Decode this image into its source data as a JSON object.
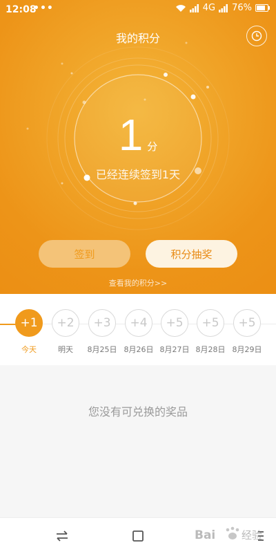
{
  "status_bar": {
    "time": "12:08",
    "dots": "•••",
    "network": "4G",
    "battery": "76%"
  },
  "header": {
    "title": "我的积分",
    "history_icon": "clock-icon"
  },
  "score": {
    "value": "1",
    "unit": "分",
    "streak_text": "已经连续签到1天"
  },
  "buttons": {
    "checkin": "签到",
    "lottery": "积分抽奖"
  },
  "view_points_link": "查看我的积分>>",
  "days": [
    {
      "points": "+1",
      "label": "今天",
      "active": true
    },
    {
      "points": "+2",
      "label": "明天",
      "active": false
    },
    {
      "points": "+3",
      "label": "8月25日",
      "active": false
    },
    {
      "points": "+4",
      "label": "8月26日",
      "active": false
    },
    {
      "points": "+5",
      "label": "8月27日",
      "active": false
    },
    {
      "points": "+5",
      "label": "8月28日",
      "active": false
    },
    {
      "points": "+5",
      "label": "8月29日",
      "active": false
    }
  ],
  "empty_message": "您没有可兑换的奖品",
  "nav": {
    "back_icon": "switch-arrows-icon",
    "home_icon": "square-icon",
    "menu_icon": "menu-icon"
  },
  "watermark": "Bai 经验",
  "colors": {
    "accent": "#f09a1c",
    "hero_bg": "#ed9418",
    "lottery_btn_bg": "#fdf3e1",
    "checkin_btn_bg": "#f4c378"
  }
}
